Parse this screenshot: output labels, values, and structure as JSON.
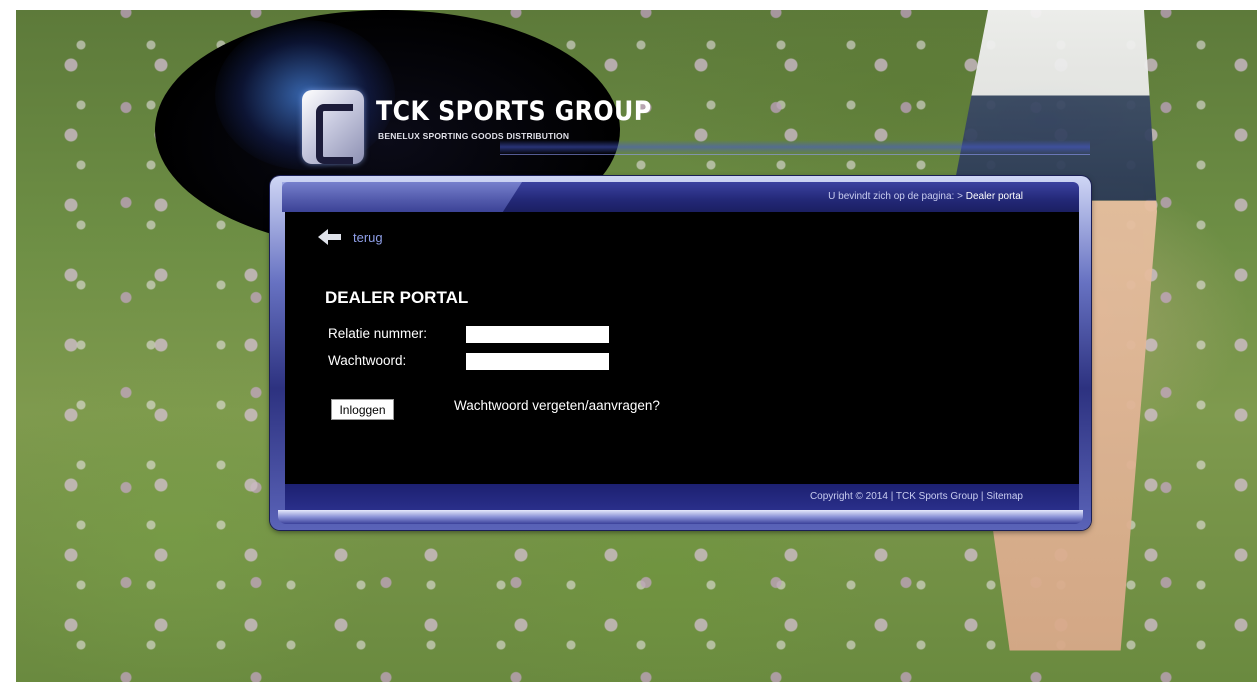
{
  "logo": {
    "title": "TCK SPORTS GROUP",
    "subtitle": "BENELUX SPORTING GOODS DISTRIBUTION"
  },
  "header": {
    "breadcrumb_prefix": "U bevindt zich op de pagina: > ",
    "breadcrumb_current": "Dealer portal"
  },
  "nav": {
    "back_label": "terug"
  },
  "form": {
    "title": "DEALER PORTAL",
    "relation_label": "Relatie nummer:",
    "relation_value": "",
    "password_label": "Wachtwoord:",
    "password_value": "",
    "login_label": "Inloggen",
    "forgot_label": "Wachtwoord vergeten/aanvragen?"
  },
  "footer": {
    "copyright": "Copyright © 2014 | TCK Sports Group | ",
    "sitemap": "Sitemap"
  },
  "colors": {
    "panel_blue": "#2d3280",
    "link_blue": "#8f9fe8",
    "body_black": "#000000"
  }
}
